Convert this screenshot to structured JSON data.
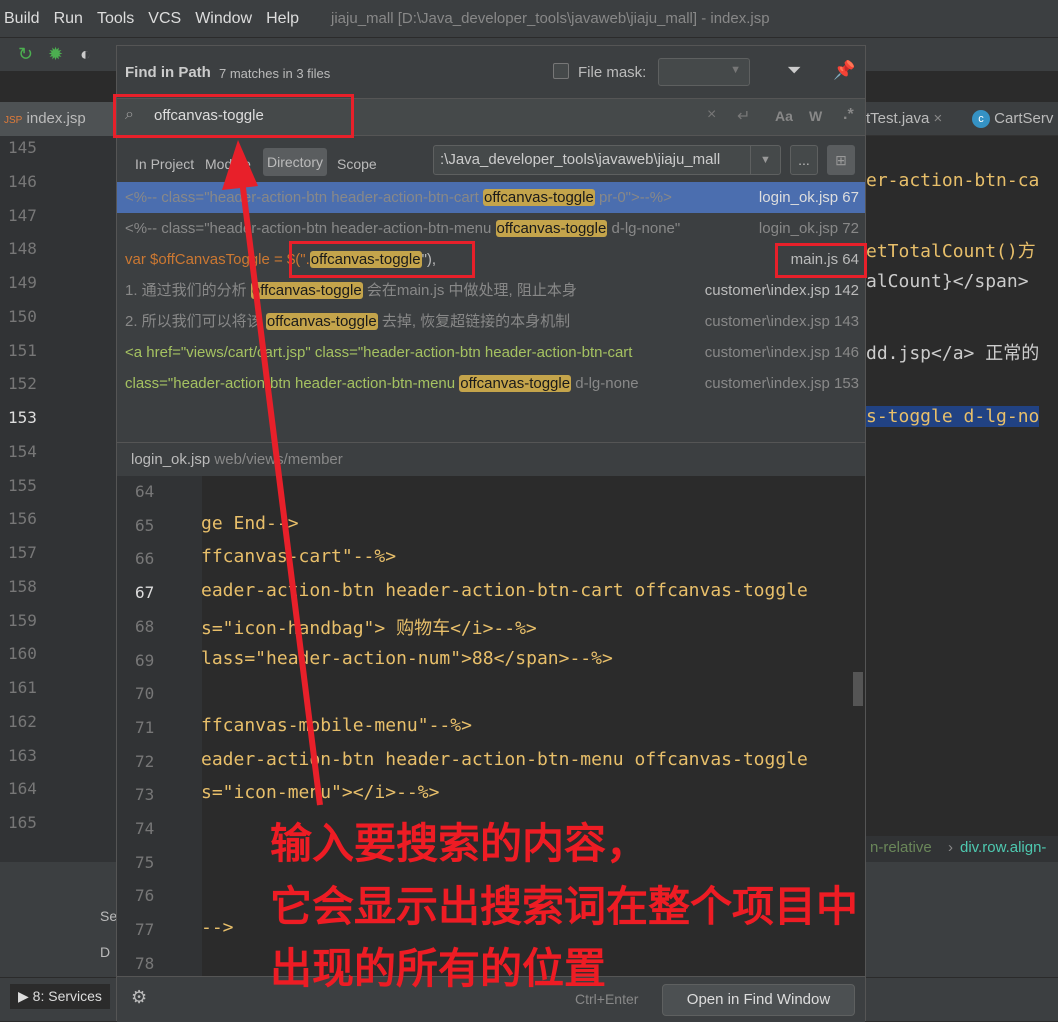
{
  "menu": {
    "items": [
      "Build",
      "Run",
      "Tools",
      "VCS",
      "Window",
      "Help"
    ],
    "title": "jiaju_mall [D:\\Java_developer_tools\\javaweb\\jiaju_mall] - index.jsp"
  },
  "tabs": [
    {
      "label": "index.jsp",
      "icon": "jsp-file-icon"
    },
    {
      "label": "tTest.java"
    },
    {
      "label": "CartServ",
      "icon": "class-icon"
    }
  ],
  "gutter": {
    "lines": [
      "145",
      "146",
      "147",
      "148",
      "149",
      "150",
      "151",
      "152",
      "153",
      "154",
      "155",
      "156",
      "157",
      "158",
      "159",
      "160",
      "161",
      "162",
      "163",
      "164",
      "165"
    ]
  },
  "right_code": [
    "er-action-btn-ca",
    "etTotalCount()方",
    "alCount}</span>",
    "dd.jsp</a> 正常的",
    "s-toggle d-lg-no"
  ],
  "breadcrumbs": [
    "n-relative",
    "div.row.align-"
  ],
  "bottom": {
    "services_label": "8: Services",
    "tab1": "Se",
    "item1": "D"
  },
  "find": {
    "title": "Find in Path",
    "summary": "7 matches in 3 files",
    "file_mask_label": "File mask:",
    "file_mask_checked": false,
    "query": "offcanvas-toggle",
    "scopes": [
      "In Project",
      "Module",
      "Directory",
      "Scope"
    ],
    "active_scope": "Directory",
    "directory": ":\\Java_developer_tools\\javaweb\\jiaju_mall",
    "browse_label": "...",
    "results": [
      {
        "pre": "<%--   class=\"header-action-btn header-action-btn-cart ",
        "match": "offcanvas-toggle",
        "post": " pr-0\">--%>",
        "file": "login_ok.jsp 67",
        "selected": true
      },
      {
        "pre": "<%--   class=\"header-action-btn header-action-btn-menu ",
        "match": "offcanvas-toggle",
        "post": " d-lg-none\"",
        "file": "login_ok.jsp 72"
      },
      {
        "pre": "var $offCanvasToggle = $(\".",
        "match": "offcanvas-toggle",
        "post": "\"),",
        "file": "main.js 64"
      },
      {
        "pre": "1. 通过我们的分析 ",
        "match": "offcanvas-toggle",
        "post": " 会在main.js 中做处理, 阻止本身",
        "file": "customer\\index.jsp 142"
      },
      {
        "pre": "2. 所以我们可以将该 ",
        "match": "offcanvas-toggle",
        "post": " 去掉, 恢复超链接的本身机制",
        "file": "customer\\index.jsp 143"
      },
      {
        "pre": "<a href=\"views/cart/cart.jsp\" class=\"header-action-btn header-action-btn-cart",
        "match": "",
        "post": "",
        "file": "customer\\index.jsp 146"
      },
      {
        "pre": "class=\"header-action-btn header-action-btn-menu ",
        "match": "offcanvas-toggle",
        "post": " d-lg-none",
        "file": "customer\\index.jsp 153"
      }
    ],
    "preview_file": "login_ok.jsp",
    "preview_path": "web/views/member",
    "preview_lines": [
      {
        "n": "64",
        "code": ""
      },
      {
        "n": "65",
        "code": "ge End-->"
      },
      {
        "n": "66",
        "code": "ffcanvas-cart\"--%>"
      },
      {
        "n": "67",
        "code": "eader-action-btn header-action-btn-cart offcanvas-toggle"
      },
      {
        "n": "68",
        "code": "s=\"icon-handbag\"> 购物车</i>--%>"
      },
      {
        "n": "69",
        "code": "lass=\"header-action-num\">88</span>--%>"
      },
      {
        "n": "70",
        "code": ""
      },
      {
        "n": "71",
        "code": "ffcanvas-mobile-menu\"--%>"
      },
      {
        "n": "72",
        "code": "eader-action-btn header-action-btn-menu offcanvas-toggle"
      },
      {
        "n": "73",
        "code": "s=\"icon-menu\"></i>--%>"
      },
      {
        "n": "74",
        "code": ""
      },
      {
        "n": "75",
        "code": ""
      },
      {
        "n": "76",
        "code": ""
      },
      {
        "n": "77",
        "code": "-->"
      },
      {
        "n": "78",
        "code": ""
      }
    ],
    "shortcut": "Ctrl+Enter",
    "open_button": "Open in Find Window"
  },
  "annotation": [
    "输入要搜索的内容，",
    "它会显示出搜索词在整个项目中",
    "出现的所有的位置"
  ],
  "colors": {
    "annotation": "#ee1c24",
    "selection": "#4b6eaf",
    "match": "#c4a44b"
  }
}
